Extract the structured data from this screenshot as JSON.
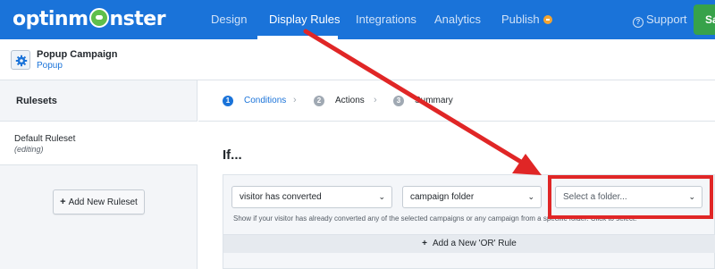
{
  "app": {
    "logo_text_a": "optinm",
    "logo_text_b": "nster"
  },
  "nav": {
    "items": [
      "Design",
      "Display Rules",
      "Integrations",
      "Analytics",
      "Publish"
    ],
    "active": "Display Rules",
    "support": "Support",
    "save": "Sa"
  },
  "campaign": {
    "title": "Popup Campaign",
    "type": "Popup"
  },
  "sidebar": {
    "heading": "Rulesets",
    "rulesets": [
      {
        "name": "Default Ruleset",
        "state": "(editing)"
      }
    ],
    "add_button": "Add New Ruleset"
  },
  "steps": [
    {
      "num": "1",
      "label": "Conditions",
      "active": true
    },
    {
      "num": "2",
      "label": "Actions",
      "active": false
    },
    {
      "num": "3",
      "label": "Summary",
      "active": false
    }
  ],
  "rule": {
    "heading": "If...",
    "condition_select": "visitor has converted",
    "target_select": "campaign folder",
    "folder_select_placeholder": "Select a folder...",
    "help_text": "Show if your visitor has already converted any of the selected campaigns or any campaign from a specific folder. Click to select.",
    "add_or_rule": "Add a New 'OR' Rule"
  },
  "colors": {
    "brand_blue": "#1a73d9",
    "save_green": "#37a24a",
    "annotation_red": "#e02626",
    "publish_badge": "#f4a430"
  }
}
